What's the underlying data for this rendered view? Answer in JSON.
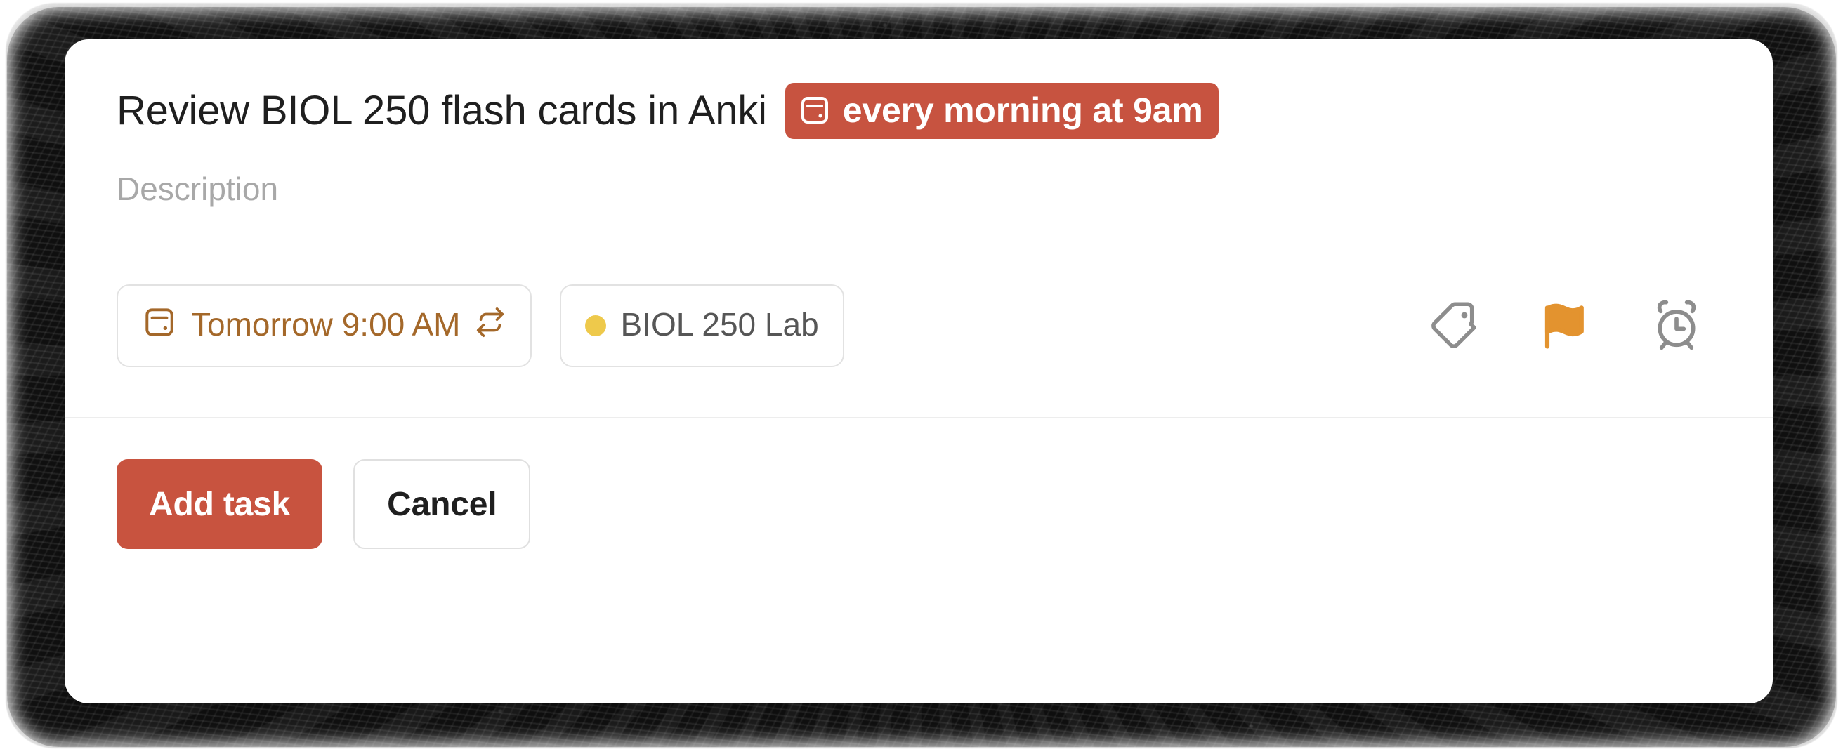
{
  "dialog": {
    "name": "add-task-dialog",
    "task_title": "Review BIOL 250 flash cards in Anki",
    "recurrence_badge": {
      "text": "every morning at 9am",
      "icon": "calendar-icon",
      "background_color": "#c75340",
      "text_color": "#ffffff"
    },
    "description_placeholder": "Description",
    "description_value": ""
  },
  "chips": {
    "date": {
      "label": "Tomorrow 9:00 AM",
      "leading_icon": "calendar-icon",
      "trailing_icon": "repeat-icon",
      "text_color": "#a4682a"
    },
    "project": {
      "label": "BIOL 250 Lab",
      "dot_color": "#eec94b",
      "text_color": "#565656"
    }
  },
  "icon_actions": [
    {
      "name": "label-icon",
      "title": "Labels",
      "color": "#8d8d8d"
    },
    {
      "name": "flag-icon",
      "title": "Priority",
      "color": "#e3932f"
    },
    {
      "name": "alarm-icon",
      "title": "Reminder",
      "color": "#8d8d8d"
    }
  ],
  "footer": {
    "add_task_label": "Add task",
    "cancel_label": "Cancel",
    "primary_color": "#c8533f"
  }
}
